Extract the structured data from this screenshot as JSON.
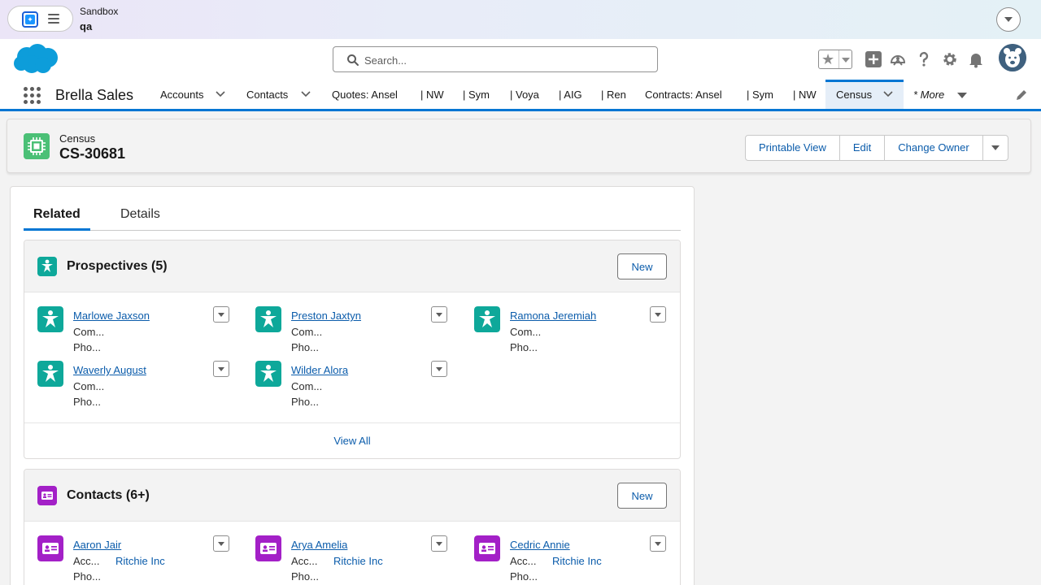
{
  "sandbox": {
    "label": "Sandbox",
    "org": "qa"
  },
  "search": {
    "placeholder": "Search..."
  },
  "app": {
    "name": "Brella Sales"
  },
  "nav": {
    "items": [
      "Accounts",
      "Contacts",
      "Quotes: Ansel",
      "| NW",
      "| Sym",
      "| Voya",
      "| AIG",
      "| Ren",
      "Contracts: Ansel",
      "| Sym",
      "| NW",
      "Census"
    ],
    "more": "* More",
    "active": "Census"
  },
  "record": {
    "type": "Census",
    "name": "CS-30681",
    "actions": [
      "Printable View",
      "Edit",
      "Change Owner"
    ]
  },
  "tabs": {
    "related": "Related",
    "details": "Details"
  },
  "prospectives": {
    "title": "Prospectives (5)",
    "new_label": "New",
    "view_all": "View All",
    "items": [
      {
        "name": "Marlowe Jaxson",
        "f1": "Com...",
        "f2": "Pho..."
      },
      {
        "name": "Preston Jaxtyn",
        "f1": "Com...",
        "f2": "Pho..."
      },
      {
        "name": "Ramona Jeremiah",
        "f1": "Com...",
        "f2": "Pho..."
      },
      {
        "name": "Waverly August",
        "f1": "Com...",
        "f2": "Pho..."
      },
      {
        "name": "Wilder Alora",
        "f1": "Com...",
        "f2": "Pho..."
      }
    ]
  },
  "contacts": {
    "title": "Contacts (6+)",
    "new_label": "New",
    "items": [
      {
        "name": "Aaron Jair",
        "f1": "Acc...",
        "f1_value": "Ritchie Inc",
        "f2": "Pho..."
      },
      {
        "name": "Arya Amelia",
        "f1": "Acc...",
        "f1_value": "Ritchie Inc",
        "f2": "Pho..."
      },
      {
        "name": "Cedric Annie",
        "f1": "Acc...",
        "f1_value": "Ritchie Inc",
        "f2": "Pho..."
      }
    ]
  },
  "colors": {
    "brand": "#0176d3",
    "prospective_icon": "#0ea89a",
    "contact_icon": "#a320c7",
    "census_icon": "#4bc076"
  }
}
